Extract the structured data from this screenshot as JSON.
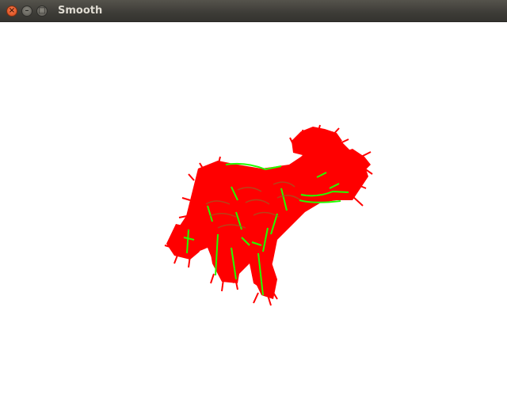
{
  "window": {
    "title": "Smooth",
    "controls": {
      "close_glyph": "×",
      "minimize_glyph": "–",
      "maximize_glyph": "□"
    }
  },
  "colors": {
    "titlebar": "#3d3c37",
    "title_text": "#dfdbd2",
    "close_button": "#e55b2b",
    "background": "#ffffff",
    "surface": "#ff0000",
    "normals": "#22ff00"
  }
}
